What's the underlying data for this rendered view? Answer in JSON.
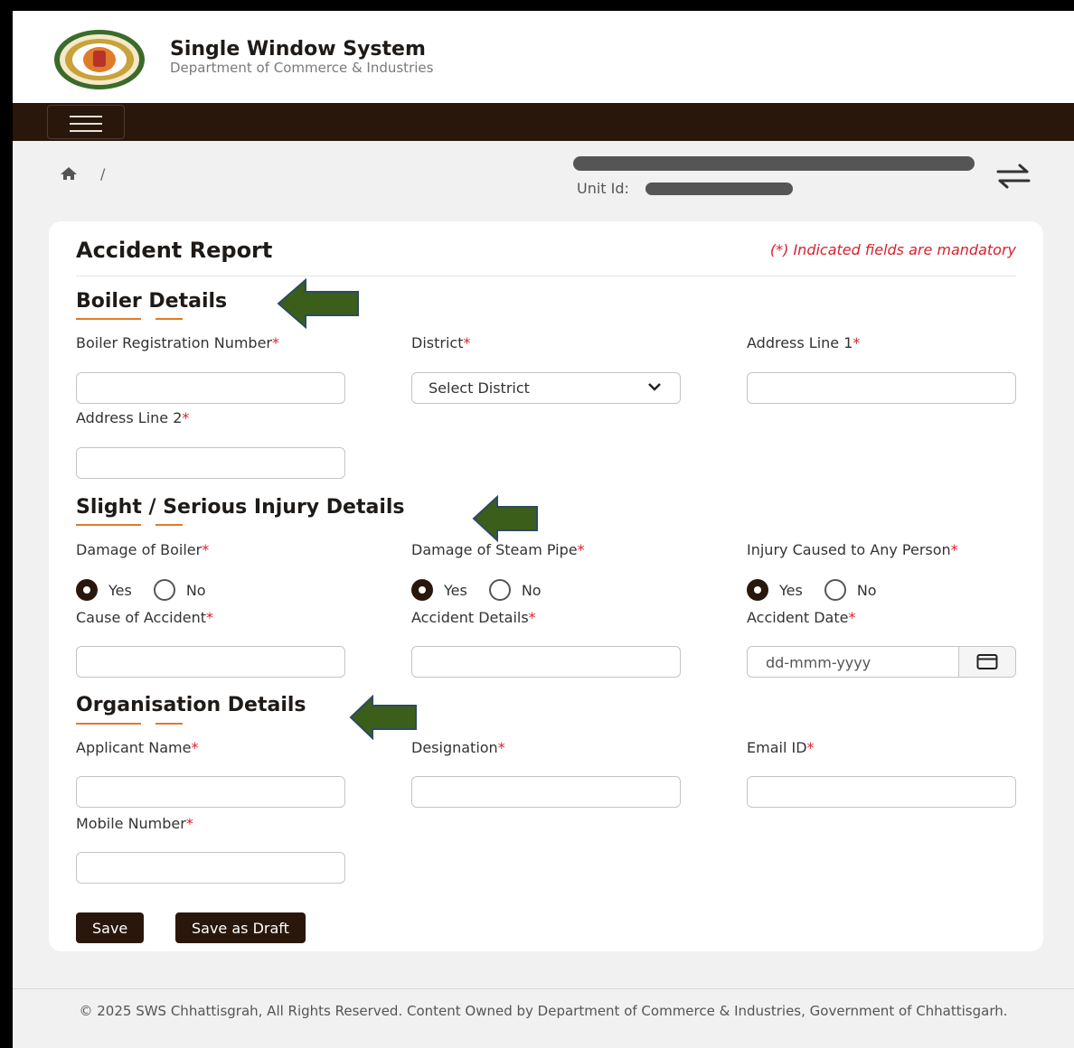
{
  "header": {
    "title": "Single Window System",
    "subtitle": "Department of Commerce & Industries"
  },
  "breadcrumb": {
    "separator": "/"
  },
  "unit": {
    "id_label": "Unit Id:"
  },
  "form": {
    "title": "Accident Report",
    "mandatory_note": "(*) Indicated fields are mandatory",
    "sections": {
      "boiler": {
        "title": "Boiler Details",
        "registration_label": "Boiler Registration Number",
        "district_label": "District",
        "district_selected": "Select District",
        "address1_label": "Address Line 1",
        "address2_label": "Address Line 2"
      },
      "injury": {
        "title": "Slight / Serious Injury Details",
        "damage_boiler_label": "Damage of Boiler",
        "damage_pipe_label": "Damage of Steam Pipe",
        "injury_person_label": "Injury Caused to Any Person",
        "yes": "Yes",
        "no": "No",
        "cause_label": "Cause of Accident",
        "details_label": "Accident Details",
        "date_label": "Accident Date",
        "date_placeholder": "dd-mmm-yyyy"
      },
      "organisation": {
        "title": "Organisation Details",
        "applicant_label": "Applicant Name",
        "designation_label": "Designation",
        "email_label": "Email ID",
        "mobile_label": "Mobile Number"
      }
    },
    "required_mark": "*",
    "buttons": {
      "save": "Save",
      "save_draft": "Save as Draft"
    }
  },
  "footer": {
    "text": "© 2025 SWS Chhattisgrah, All Rights Reserved. Content Owned by Department of Commerce & Industries, Government of Chhattisgarh."
  },
  "colors": {
    "brand_dark": "#2a170b",
    "accent_underline": "#e07b2a",
    "required_red": "#d8212e",
    "annotation_arrow": "#3b5e1a"
  },
  "icons": [
    "state-emblem-logo",
    "menu-icon",
    "home-icon",
    "swap-icon",
    "chevron-down-icon",
    "calendar-icon",
    "arrow-left-icon"
  ]
}
